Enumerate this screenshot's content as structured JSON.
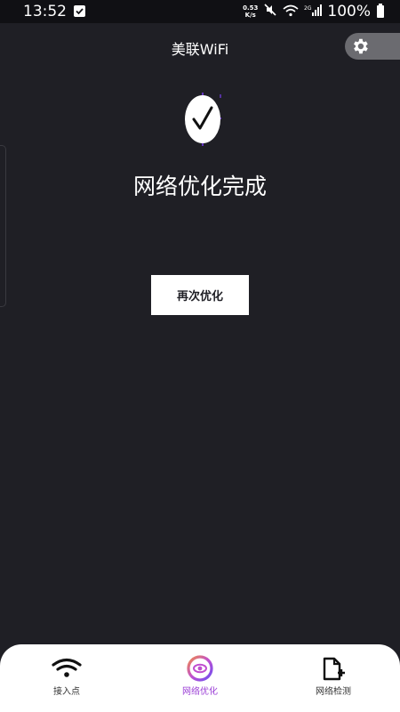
{
  "status_bar": {
    "time": "13:52",
    "net_speed_value": "0.53",
    "net_speed_unit": "K/s",
    "battery": "100%"
  },
  "header": {
    "title": "美联WiFi"
  },
  "main": {
    "result_title": "网络优化完成",
    "retry_label": "再次优化"
  },
  "bottom_nav": {
    "items": [
      {
        "label": "接入点",
        "icon": "wifi-icon",
        "active": false
      },
      {
        "label": "网络优化",
        "icon": "optimize-icon",
        "active": true
      },
      {
        "label": "网络检测",
        "icon": "document-plus-icon",
        "active": false
      }
    ]
  },
  "colors": {
    "background": "#1f1f25",
    "accent": "#9b3fd6",
    "nav_background": "#ffffff"
  }
}
